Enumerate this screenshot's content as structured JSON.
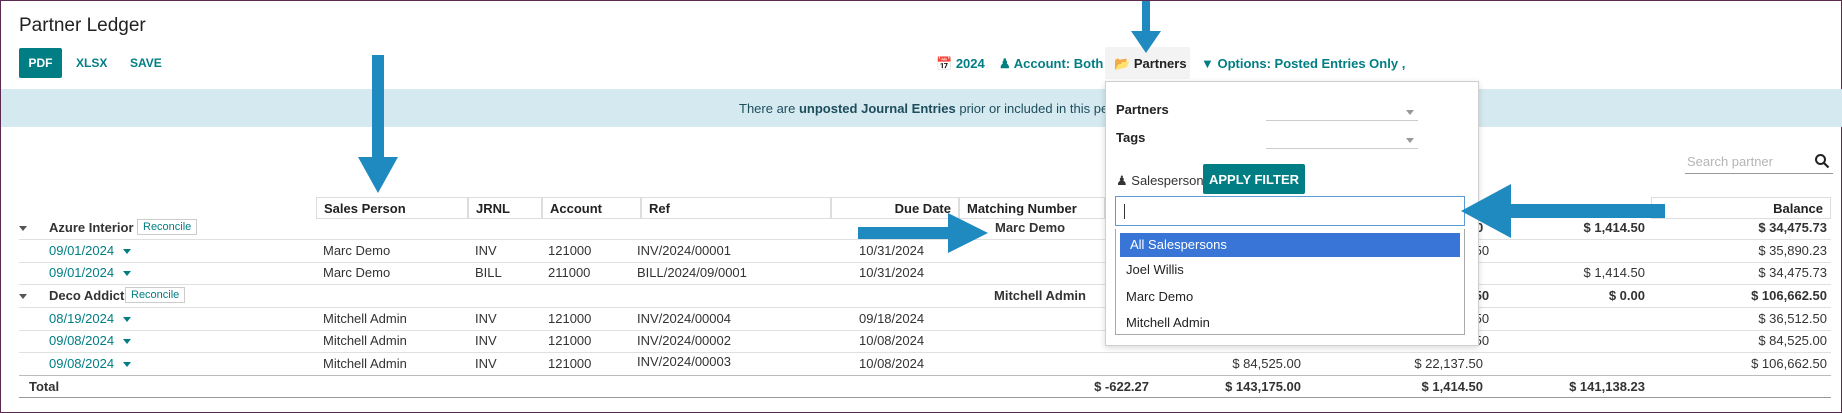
{
  "page": {
    "title": "Partner Ledger"
  },
  "toolbar": {
    "pdf": "PDF",
    "xlsx": "XLSX",
    "save": "SAVE"
  },
  "filters": {
    "year": "2024",
    "account": "Account: Both",
    "partners": "Partners",
    "options": "Options: Posted Entries Only ,"
  },
  "banner": {
    "prefix": "There are ",
    "bold": "unposted Journal Entries",
    "suffix": " prior or included in this peri"
  },
  "search": {
    "placeholder": "Search partner"
  },
  "columns": {
    "sales_person": "Sales Person",
    "jrnl": "JRNL",
    "account": "Account",
    "ref": "Ref",
    "due_date": "Due Date",
    "matching_number": "Matching Number",
    "balance": "Balance"
  },
  "groups": [
    {
      "name": "Azure Interior",
      "reconcile": "Reconcile",
      "salesperson": "Marc Demo",
      "partial_num": "0",
      "col_b": "$ 1,414.50",
      "balance": "$ 34,475.73",
      "rows": [
        {
          "date": "09/01/2024",
          "sp": "Marc Demo",
          "jrnl": "INV",
          "account": "121000",
          "ref": "INV/2024/00001",
          "due": "10/31/2024",
          "c3": ".50",
          "c4": "",
          "balance": "$ 35,890.23"
        },
        {
          "date": "09/01/2024",
          "sp": "Marc Demo",
          "jrnl": "BILL",
          "account": "211000",
          "ref": "BILL/2024/09/0001",
          "due": "10/31/2024",
          "c3": "",
          "c4": "$ 1,414.50",
          "balance": "$ 34,475.73"
        }
      ]
    },
    {
      "name": "Deco Addict",
      "reconcile": "Reconcile",
      "salesperson": "Mitchell Admin",
      "partial_num": ".50",
      "col_b": "$ 0.00",
      "balance": "$ 106,662.50",
      "rows": [
        {
          "date": "08/19/2024",
          "sp": "Mitchell Admin",
          "jrnl": "INV",
          "account": "121000",
          "ref": "INV/2024/00004",
          "due": "09/18/2024",
          "c3": ".50",
          "balance": "$ 36,512.50"
        },
        {
          "date": "09/08/2024",
          "sp": "Mitchell Admin",
          "jrnl": "INV",
          "account": "121000",
          "ref": "INV/2024/00002",
          "due": "10/08/2024",
          "c3": ".50",
          "balance": "$ 84,525.00"
        },
        {
          "date": "09/08/2024",
          "sp": "Mitchell Admin",
          "jrnl": "INV",
          "account": "121000",
          "ref": "INV/2024/00003",
          "due": "10/08/2024",
          "c2": "$ 84,525.00",
          "c3": "$ 22,137.50",
          "balance": "$ 106,662.50"
        }
      ]
    }
  ],
  "total": {
    "label": "Total",
    "t1": "$ -622.27",
    "t2": "$ 143,175.00",
    "t3": "$ 1,414.50",
    "t4": "$ 141,138.23"
  },
  "dropdown": {
    "partners_label": "Partners",
    "tags_label": "Tags",
    "salesperson_label": "Salesperson",
    "apply": "APPLY FILTER",
    "options": [
      "All Salespersons",
      "Joel Willis",
      "Marc Demo",
      "Mitchell Admin"
    ]
  },
  "colors": {
    "accent": "#017e84",
    "banner": "#d4eaf0",
    "arrow": "#1f8ac0",
    "highlight": "#3875d7"
  }
}
